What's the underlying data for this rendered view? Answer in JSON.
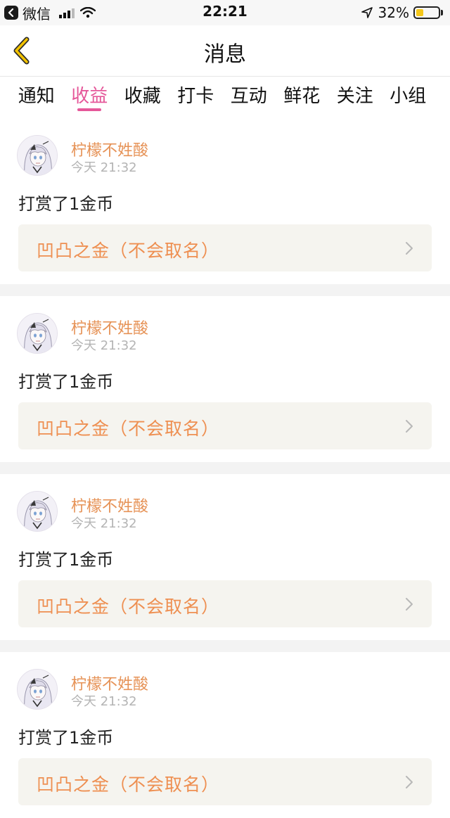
{
  "status_bar": {
    "back_app": "微信",
    "time": "22:21",
    "battery_text": "32%",
    "battery_level": 0.32,
    "battery_color": "#f5c71a"
  },
  "header": {
    "title": "消息",
    "back_icon": "chevron-left-icon",
    "accent_color": "#f2c200"
  },
  "tabs": [
    {
      "label": "通知",
      "active": false
    },
    {
      "label": "收益",
      "active": true
    },
    {
      "label": "收藏",
      "active": false
    },
    {
      "label": "打卡",
      "active": false
    },
    {
      "label": "互动",
      "active": false
    },
    {
      "label": "鲜花",
      "active": false
    },
    {
      "label": "关注",
      "active": false
    },
    {
      "label": "小组",
      "active": false
    }
  ],
  "theme": {
    "active_tab_color": "#e5589a",
    "username_color": "#e69256",
    "link_color": "#ee8f51"
  },
  "feed": [
    {
      "username": "柠檬不姓酸",
      "time": "今天 21:32",
      "action": "打赏了1金币",
      "link_title": "凹凸之金（不会取名）"
    },
    {
      "username": "柠檬不姓酸",
      "time": "今天 21:32",
      "action": "打赏了1金币",
      "link_title": "凹凸之金（不会取名）"
    },
    {
      "username": "柠檬不姓酸",
      "time": "今天 21:32",
      "action": "打赏了1金币",
      "link_title": "凹凸之金（不会取名）"
    },
    {
      "username": "柠檬不姓酸",
      "time": "今天 21:32",
      "action": "打赏了1金币",
      "link_title": "凹凸之金（不会取名）"
    }
  ]
}
